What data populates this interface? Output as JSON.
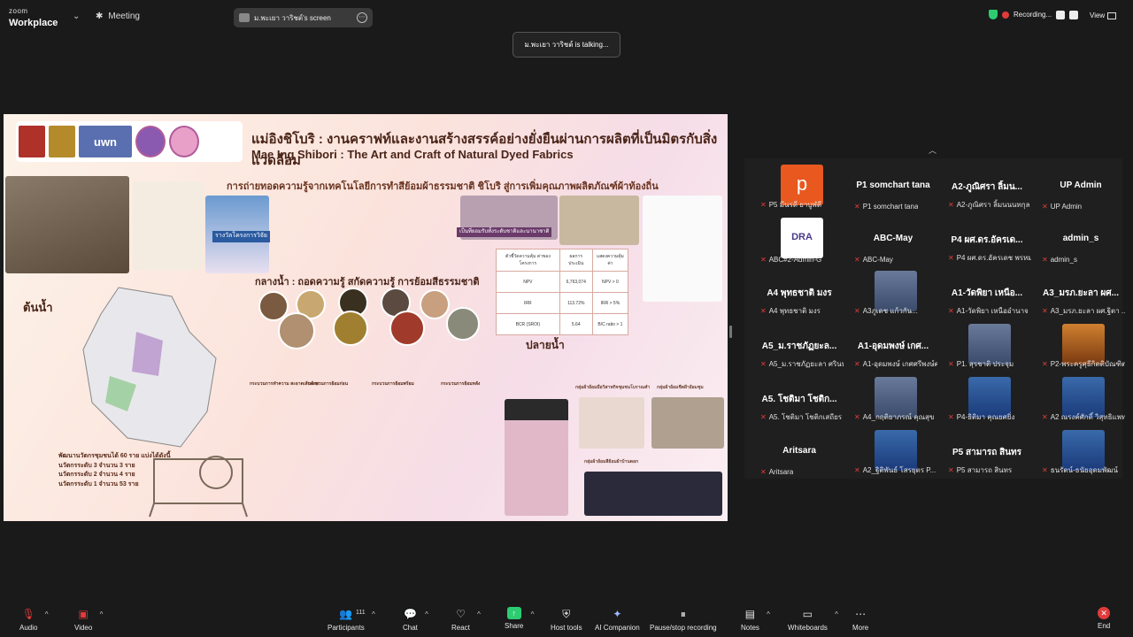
{
  "topbar": {
    "brand_small": "zoom",
    "brand_large": "Workplace",
    "meeting_label": "Meeting",
    "share_title": "ม.พะเยา วาริชต์'s screen",
    "recording_label": "Recording...",
    "view_label": "View"
  },
  "talking": "ม.พะเยา วาริชต์ is talking...",
  "slide": {
    "title_th": "แม่อิงชิโบริ : งานคราฟท์และงานสร้างสรรค์อย่างยั่งยืนผ่านการผลิตที่เป็นมิตรกับสิ่งแวดล้อม",
    "title_en": "Mae Ing Shibori : The Art and Craft of Natural Dyed Fabrics",
    "subhead": "การถ่ายทอดความรู้จากเทคโนโลยีการทำสีย้อมผ้าธรรมชาติ ชิโบริ สู่การเพิ่มคุณภาพผลิตภัณฑ์ผ้าท้องถิ่น",
    "logo_text": "uwn",
    "upstream": "ต้นน้ำ",
    "midstream": "กลางน้ำ : ถอดความรู้ สกัดความรู้ การย้อมสีธรรมชาติ",
    "downstream": "ปลายน้ำ",
    "award": "รางวัลโครงการวิจัย",
    "standard": "เป็นที่ยอมรับทั้งระดับชาติและนานาชาติ",
    "stat_lines": [
      "พัฒนานวัตกรชุมชนได้ 60 ราย แบ่งได้ดังนี้",
      "นวัตกรระดับ 3 จำนวน 3 ราย",
      "นวัตกรระดับ 2 จำนวน 4 ราย",
      "นวัตกรระดับ 1 จำนวน 53 ราย"
    ],
    "table": [
      [
        "ตัวชี้วัดความคุ้ม ค่าของโครงการ",
        "ผลการ ประเมิน",
        "แสดงความคุ้มค่า"
      ],
      [
        "NPV",
        "6,763,074",
        "NPV > 0"
      ],
      [
        "IRR",
        "113.72%",
        "IRR > 5%"
      ],
      [
        "BCR (SROI)",
        "5.64",
        "B/C ratio > 1"
      ]
    ],
    "process_labels": [
      "กระบวนการทำความ สะอาดเส้นด้าย",
      "กระบวนการย้อมก่อน",
      "กระบวนการย้อมพร้อม",
      "กระบวนการย้อมหลัง"
    ],
    "group_labels": [
      "กลุ่มผ้าย้อมมือวิสาหกิจชุมชนโบราณคำ",
      "กลุ่มผ้าย้อมชีตฝ้าย้อมชุม",
      "กลุ่มผ้าย้อมสีย้อมผ้าบ้านดอก"
    ]
  },
  "participants": [
    {
      "name": "",
      "caption": "P5 มีนรดี ยาบูฬดี",
      "avatar": "p"
    },
    {
      "name": "P1 somchart tana",
      "caption": "P1 somchart tana",
      "avatar": ""
    },
    {
      "name": "A2-ภูณิศรา ลิ้มน...",
      "caption": "A2-ภูณิศรา ลิ้มนนนทกุล",
      "avatar": ""
    },
    {
      "name": "UP Admin",
      "caption": "UP Admin",
      "avatar": ""
    },
    {
      "name": "",
      "caption": "ABC#2-Admin-G",
      "avatar": "DRA"
    },
    {
      "name": "ABC-May",
      "caption": "ABC-May",
      "avatar": ""
    },
    {
      "name": "P4 ผศ.ดร.อัครเด...",
      "caption": "P4 ผศ.ดร.อัครเดช พรหม...",
      "avatar": ""
    },
    {
      "name": "admin_s",
      "caption": "admin_s",
      "avatar": ""
    },
    {
      "name": "A4 พุทธชาติ มงร",
      "caption": "A4 พุทธชาติ มงร",
      "avatar": ""
    },
    {
      "name": "",
      "caption": "A3ภูเดช แก้วกัน...",
      "avatar": "photo"
    },
    {
      "name": "A1-วัดพิยา เหนือ...",
      "caption": "A1-วัดพิยา เหนืออำนาจ",
      "avatar": ""
    },
    {
      "name": "A3_มรภ.ยะลา ผศ...",
      "caption": "A3_มรภ.ยะลา ผศ.ฐิตา ...",
      "avatar": ""
    },
    {
      "name": "A5_ม.ราชภัฏยะล...",
      "caption": "A5_ม.ราชภัฏยะลา ศรินท...",
      "avatar": ""
    },
    {
      "name": "A1-อุดมพงษ์ เกศ...",
      "caption": "A1-อุดมพงษ์ เกศศรีพงษ์ศา",
      "avatar": ""
    },
    {
      "name": "",
      "caption": "P1. สุรชาติ ประจุม",
      "avatar": "photo"
    },
    {
      "name": "",
      "caption": "P2-พระครูศุธีกิตติบัณฑิต...",
      "avatar": "photo3"
    },
    {
      "name": "A5. โชติมา โชติก...",
      "caption": "A5. โชติมา โชติกเสถียร",
      "avatar": ""
    },
    {
      "name": "",
      "caption": "A4_กฤติยาภรณ์ คุณสุข",
      "avatar": "photo"
    },
    {
      "name": "",
      "caption": "P4-ธิติมา คุณยศยิ่ง",
      "avatar": "photo2"
    },
    {
      "name": "",
      "caption": "A2 ณรงค์ศักดิ์ วิสุทธิแพทย์",
      "avatar": "photo2"
    },
    {
      "name": "Aritsara",
      "caption": "Aritsara",
      "avatar": ""
    },
    {
      "name": "",
      "caption": "A2_ฐิติพันธ์ โสรยุตร P...",
      "avatar": "photo2"
    },
    {
      "name": "P5 สามารถ สินทร",
      "caption": "P5 สามารถ สินทร",
      "avatar": ""
    },
    {
      "name": "",
      "caption": "ธนรัตน์-ธนัยอุดมพัฒน์",
      "avatar": "photo2"
    }
  ],
  "toolbar": {
    "audio": "Audio",
    "video": "Video",
    "participants": "Participants",
    "participants_count": "111",
    "chat": "Chat",
    "react": "React",
    "share": "Share",
    "host_tools": "Host tools",
    "ai_companion": "AI Companion",
    "pause_recording": "Pause/stop recording",
    "notes": "Notes",
    "whiteboards": "Whiteboards",
    "more": "More",
    "end": "End"
  }
}
